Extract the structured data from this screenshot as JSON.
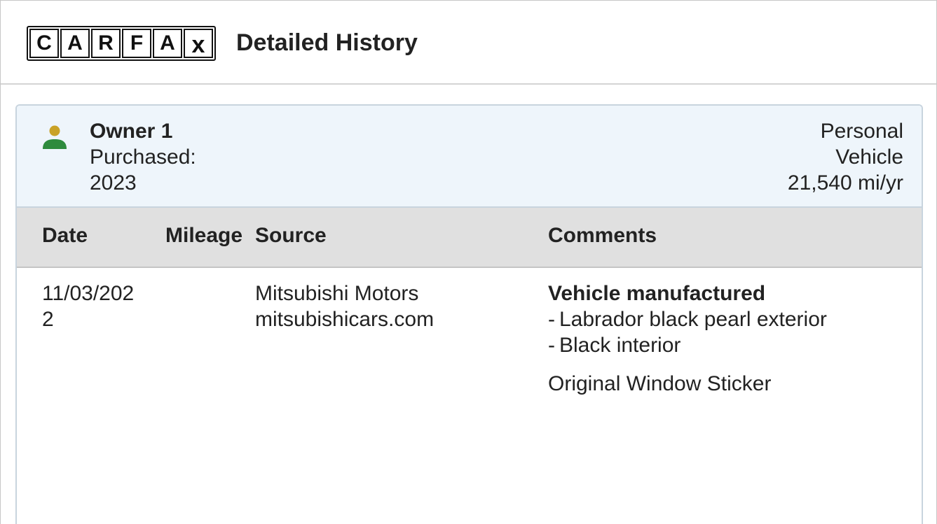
{
  "header": {
    "logo_letters": [
      "C",
      "A",
      "R",
      "F",
      "A",
      "x"
    ],
    "title": "Detailed History"
  },
  "owner": {
    "name": "Owner 1",
    "purchased_label": "Purchased:",
    "purchased_year": "2023",
    "type_line1": "Personal",
    "type_line2": "Vehicle",
    "mileage_per_year": "21,540 mi/yr",
    "icon": "person-icon",
    "colors": {
      "icon_head": "#c9a227",
      "icon_body": "#2e8b3d",
      "panel_bg": "#eef5fb"
    }
  },
  "table": {
    "columns": [
      "Date",
      "Mileage",
      "Source",
      "Comments"
    ],
    "rows": [
      {
        "date": "11/03/2022",
        "mileage": "",
        "source_line1": "Mitsubishi Motors",
        "source_line2": "mitsubishicars.com",
        "comment_title": "Vehicle manufactured",
        "comment_bullets": [
          "Labrador black pearl exterior",
          "Black interior"
        ],
        "comment_link": "Original Window Sticker"
      }
    ]
  }
}
